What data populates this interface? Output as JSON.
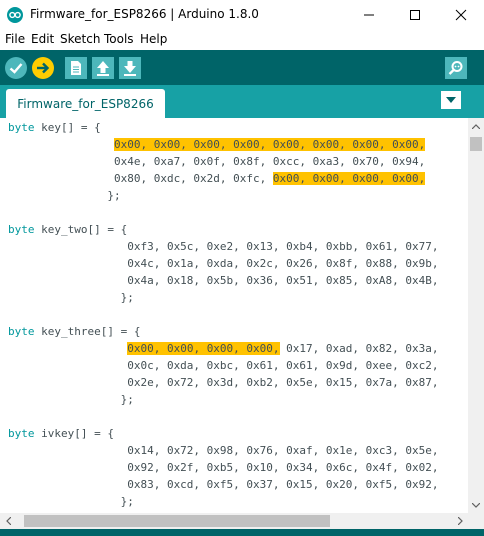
{
  "window": {
    "title": "Firmware_for_ESP8266 | Arduino 1.8.0"
  },
  "menu": {
    "items": [
      "File",
      "Edit",
      "Sketch",
      "Tools",
      "Help"
    ]
  },
  "toolbar": {
    "buttons": [
      "verify-icon",
      "upload-arrow-icon",
      "new-file-icon",
      "open-upload-icon",
      "save-download-icon",
      "serial-monitor-icon"
    ]
  },
  "tabs": [
    {
      "label": "Firmware_for_ESP8266"
    }
  ],
  "colors": {
    "toolbar": "#006468",
    "tabbar": "#17a1a5",
    "keyword": "#00979c",
    "highlight": "#ffc200",
    "text": "#434f54"
  },
  "code": [
    [
      "byte key[] = {"
    ],
    [
      "                ",
      "0x00, 0x00, 0x00, 0x00, 0x00, 0x00, 0x00, 0x00,"
    ],
    [
      "                0x4e, 0xa7, 0x0f, 0x8f, 0xcc, 0xa3, 0x70, 0x94,"
    ],
    [
      "                0x80, 0xdc, 0x2d, 0xfc, ",
      "0x00, 0x00, 0x00, 0x00,"
    ],
    [
      "               };"
    ],
    [
      ""
    ],
    [
      "byte key_two[] = {"
    ],
    [
      "                  0xf3, 0x5c, 0xe2, 0x13, 0xb4, 0xbb, 0x61, 0x77,"
    ],
    [
      "                  0x4c, 0x1a, 0xda, 0x2c, 0x26, 0x8f, 0x88, 0x9b,"
    ],
    [
      "                  0x4a, 0x18, 0x5b, 0x36, 0x51, 0x85, 0xA8, 0x4B,"
    ],
    [
      "                 };"
    ],
    [
      ""
    ],
    [
      "byte key_three[] = {"
    ],
    [
      "                  ",
      "0x00, 0x00, 0x00, 0x00,",
      " 0x17, 0xad, 0x82, 0x3a,"
    ],
    [
      "                  0x0c, 0xda, 0xbc, 0x61, 0x61, 0x9d, 0xee, 0xc2,"
    ],
    [
      "                  0x2e, 0x72, 0x3d, 0xb2, 0x5e, 0x15, 0x7a, 0x87,"
    ],
    [
      "                 };"
    ],
    [
      ""
    ],
    [
      "byte ivkey[] = {"
    ],
    [
      "                  0x14, 0x72, 0x98, 0x76, 0xaf, 0x1e, 0xc3, 0x5e,"
    ],
    [
      "                  0x92, 0x2f, 0xb5, 0x10, 0x34, 0x6c, 0x4f, 0x02,"
    ],
    [
      "                  0x83, 0xcd, 0xf5, 0x37, 0x15, 0x20, 0xf5, 0x92,"
    ],
    [
      "                 };"
    ]
  ]
}
